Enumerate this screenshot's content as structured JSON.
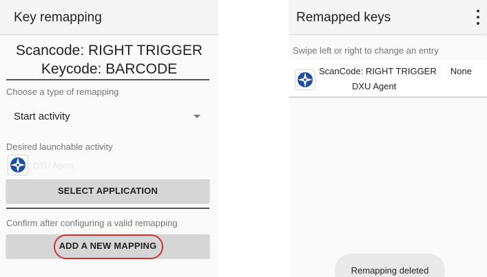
{
  "left_screen": {
    "title": "Key remapping",
    "scancode_line": "Scancode: RIGHT TRIGGER",
    "keycode_line": "Keycode: BARCODE",
    "type_caption": "Choose a type of remapping",
    "type_selected": "Start activity",
    "activity_caption": "Desired launchable activity",
    "activity_icon": "dxu-agent-compass-icon",
    "activity_label_faded": "DXU Agent",
    "select_app_button": "SELECT APPLICATION",
    "confirm_caption": "Confirm after configuring a valid remapping",
    "add_mapping_button": "ADD A NEW MAPPING",
    "highlight_color": "#d32f2f"
  },
  "right_screen": {
    "title": "Remapped keys",
    "menu_icon": "overflow-menu-icon",
    "hint": "Swipe left or right to change an entry",
    "entries": [
      {
        "scancode": "ScanCode: RIGHT TRIGGER",
        "keycode": "None",
        "app": "DXU Agent",
        "icon": "dxu-agent-compass-icon"
      }
    ],
    "toast": "Remapping deleted"
  },
  "colors": {
    "icon_blue": "#1e4fa3",
    "button_gray": "#d6d6d6",
    "background": "#fafafa"
  }
}
